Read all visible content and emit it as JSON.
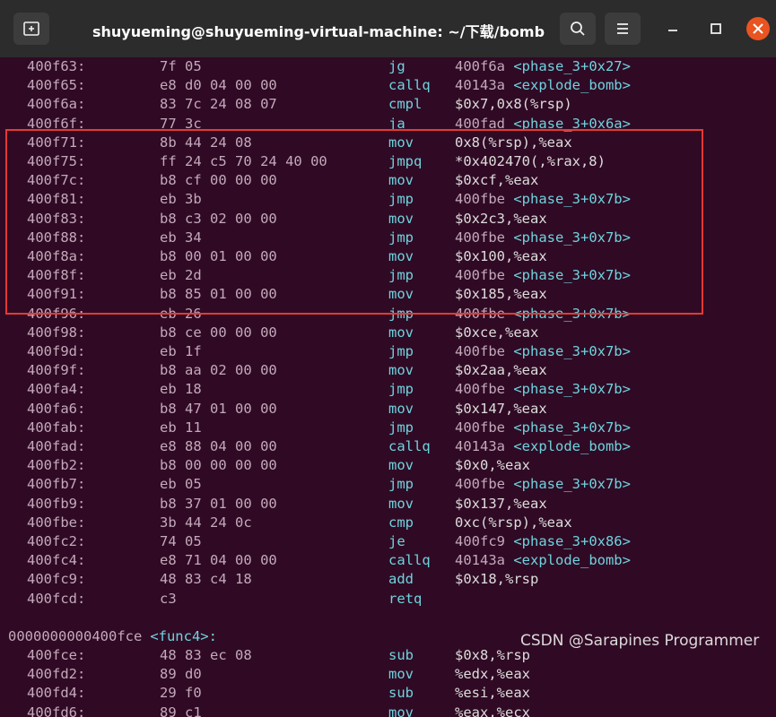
{
  "window": {
    "title": "shuyueming@shuyueming-virtual-machine: ~/下载/bomb"
  },
  "lines": [
    {
      "addr": "400f63:",
      "bytes": [
        "7f",
        "05"
      ],
      "mnem": "jg",
      "ops_n": "400f6a",
      "ops_s": "<phase_3+0x27>"
    },
    {
      "addr": "400f65:",
      "bytes": [
        "e8",
        "d0",
        "04",
        "00",
        "00"
      ],
      "mnem": "callq",
      "ops_n": "40143a",
      "ops_s": "<explode_bomb>"
    },
    {
      "addr": "400f6a:",
      "bytes": [
        "83",
        "7c",
        "24",
        "08",
        "07"
      ],
      "mnem": "cmpl",
      "ops_n": "",
      "ops_s": "$0x7,0x8(%rsp)"
    },
    {
      "addr": "400f6f:",
      "bytes": [
        "77",
        "3c"
      ],
      "mnem": "ja",
      "ops_n": "400fad",
      "ops_s": "<phase_3+0x6a>"
    },
    {
      "addr": "400f71:",
      "bytes": [
        "8b",
        "44",
        "24",
        "08"
      ],
      "mnem": "mov",
      "ops_n": "",
      "ops_s": "0x8(%rsp),%eax"
    },
    {
      "addr": "400f75:",
      "bytes": [
        "ff",
        "24",
        "c5",
        "70",
        "24",
        "40",
        "00"
      ],
      "mnem": "jmpq",
      "ops_n": "",
      "ops_s": "*0x402470(,%rax,8)"
    },
    {
      "addr": "400f7c:",
      "bytes": [
        "b8",
        "cf",
        "00",
        "00",
        "00"
      ],
      "mnem": "mov",
      "ops_n": "",
      "ops_s": "$0xcf,%eax"
    },
    {
      "addr": "400f81:",
      "bytes": [
        "eb",
        "3b"
      ],
      "mnem": "jmp",
      "ops_n": "400fbe",
      "ops_s": "<phase_3+0x7b>"
    },
    {
      "addr": "400f83:",
      "bytes": [
        "b8",
        "c3",
        "02",
        "00",
        "00"
      ],
      "mnem": "mov",
      "ops_n": "",
      "ops_s": "$0x2c3,%eax"
    },
    {
      "addr": "400f88:",
      "bytes": [
        "eb",
        "34"
      ],
      "mnem": "jmp",
      "ops_n": "400fbe",
      "ops_s": "<phase_3+0x7b>"
    },
    {
      "addr": "400f8a:",
      "bytes": [
        "b8",
        "00",
        "01",
        "00",
        "00"
      ],
      "mnem": "mov",
      "ops_n": "",
      "ops_s": "$0x100,%eax"
    },
    {
      "addr": "400f8f:",
      "bytes": [
        "eb",
        "2d"
      ],
      "mnem": "jmp",
      "ops_n": "400fbe",
      "ops_s": "<phase_3+0x7b>"
    },
    {
      "addr": "400f91:",
      "bytes": [
        "b8",
        "85",
        "01",
        "00",
        "00"
      ],
      "mnem": "mov",
      "ops_n": "",
      "ops_s": "$0x185,%eax"
    },
    {
      "addr": "400f96:",
      "bytes": [
        "eb",
        "26"
      ],
      "mnem": "jmp",
      "ops_n": "400fbe",
      "ops_s": "<phase_3+0x7b>"
    },
    {
      "addr": "400f98:",
      "bytes": [
        "b8",
        "ce",
        "00",
        "00",
        "00"
      ],
      "mnem": "mov",
      "ops_n": "",
      "ops_s": "$0xce,%eax"
    },
    {
      "addr": "400f9d:",
      "bytes": [
        "eb",
        "1f"
      ],
      "mnem": "jmp",
      "ops_n": "400fbe",
      "ops_s": "<phase_3+0x7b>"
    },
    {
      "addr": "400f9f:",
      "bytes": [
        "b8",
        "aa",
        "02",
        "00",
        "00"
      ],
      "mnem": "mov",
      "ops_n": "",
      "ops_s": "$0x2aa,%eax"
    },
    {
      "addr": "400fa4:",
      "bytes": [
        "eb",
        "18"
      ],
      "mnem": "jmp",
      "ops_n": "400fbe",
      "ops_s": "<phase_3+0x7b>"
    },
    {
      "addr": "400fa6:",
      "bytes": [
        "b8",
        "47",
        "01",
        "00",
        "00"
      ],
      "mnem": "mov",
      "ops_n": "",
      "ops_s": "$0x147,%eax"
    },
    {
      "addr": "400fab:",
      "bytes": [
        "eb",
        "11"
      ],
      "mnem": "jmp",
      "ops_n": "400fbe",
      "ops_s": "<phase_3+0x7b>"
    },
    {
      "addr": "400fad:",
      "bytes": [
        "e8",
        "88",
        "04",
        "00",
        "00"
      ],
      "mnem": "callq",
      "ops_n": "40143a",
      "ops_s": "<explode_bomb>"
    },
    {
      "addr": "400fb2:",
      "bytes": [
        "b8",
        "00",
        "00",
        "00",
        "00"
      ],
      "mnem": "mov",
      "ops_n": "",
      "ops_s": "$0x0,%eax"
    },
    {
      "addr": "400fb7:",
      "bytes": [
        "eb",
        "05"
      ],
      "mnem": "jmp",
      "ops_n": "400fbe",
      "ops_s": "<phase_3+0x7b>"
    },
    {
      "addr": "400fb9:",
      "bytes": [
        "b8",
        "37",
        "01",
        "00",
        "00"
      ],
      "mnem": "mov",
      "ops_n": "",
      "ops_s": "$0x137,%eax"
    },
    {
      "addr": "400fbe:",
      "bytes": [
        "3b",
        "44",
        "24",
        "0c"
      ],
      "mnem": "cmp",
      "ops_n": "",
      "ops_s": "0xc(%rsp),%eax"
    },
    {
      "addr": "400fc2:",
      "bytes": [
        "74",
        "05"
      ],
      "mnem": "je",
      "ops_n": "400fc9",
      "ops_s": "<phase_3+0x86>"
    },
    {
      "addr": "400fc4:",
      "bytes": [
        "e8",
        "71",
        "04",
        "00",
        "00"
      ],
      "mnem": "callq",
      "ops_n": "40143a",
      "ops_s": "<explode_bomb>"
    },
    {
      "addr": "400fc9:",
      "bytes": [
        "48",
        "83",
        "c4",
        "18"
      ],
      "mnem": "add",
      "ops_n": "",
      "ops_s": "$0x18,%rsp"
    },
    {
      "addr": "400fcd:",
      "bytes": [
        "c3"
      ],
      "mnem": "retq",
      "ops_n": "",
      "ops_s": ""
    }
  ],
  "func4_header": {
    "addr": "0000000000400fce",
    "sym": "<func4>:"
  },
  "func4_lines": [
    {
      "addr": "400fce:",
      "bytes": [
        "48",
        "83",
        "ec",
        "08"
      ],
      "mnem": "sub",
      "ops_n": "",
      "ops_s": "$0x8,%rsp"
    },
    {
      "addr": "400fd2:",
      "bytes": [
        "89",
        "d0"
      ],
      "mnem": "mov",
      "ops_n": "",
      "ops_s": "%edx,%eax"
    },
    {
      "addr": "400fd4:",
      "bytes": [
        "29",
        "f0"
      ],
      "mnem": "sub",
      "ops_n": "",
      "ops_s": "%esi,%eax"
    },
    {
      "addr": "400fd6:",
      "bytes": [
        "89",
        "c1"
      ],
      "mnem": "mov",
      "ops_n": "",
      "ops_s": "%eax,%ecx"
    }
  ],
  "watermark": "CSDN @Sarapines Programmer",
  "colors": {
    "background": "#300a24",
    "highlight_box": "#e53935",
    "close_button": "#e95420"
  }
}
